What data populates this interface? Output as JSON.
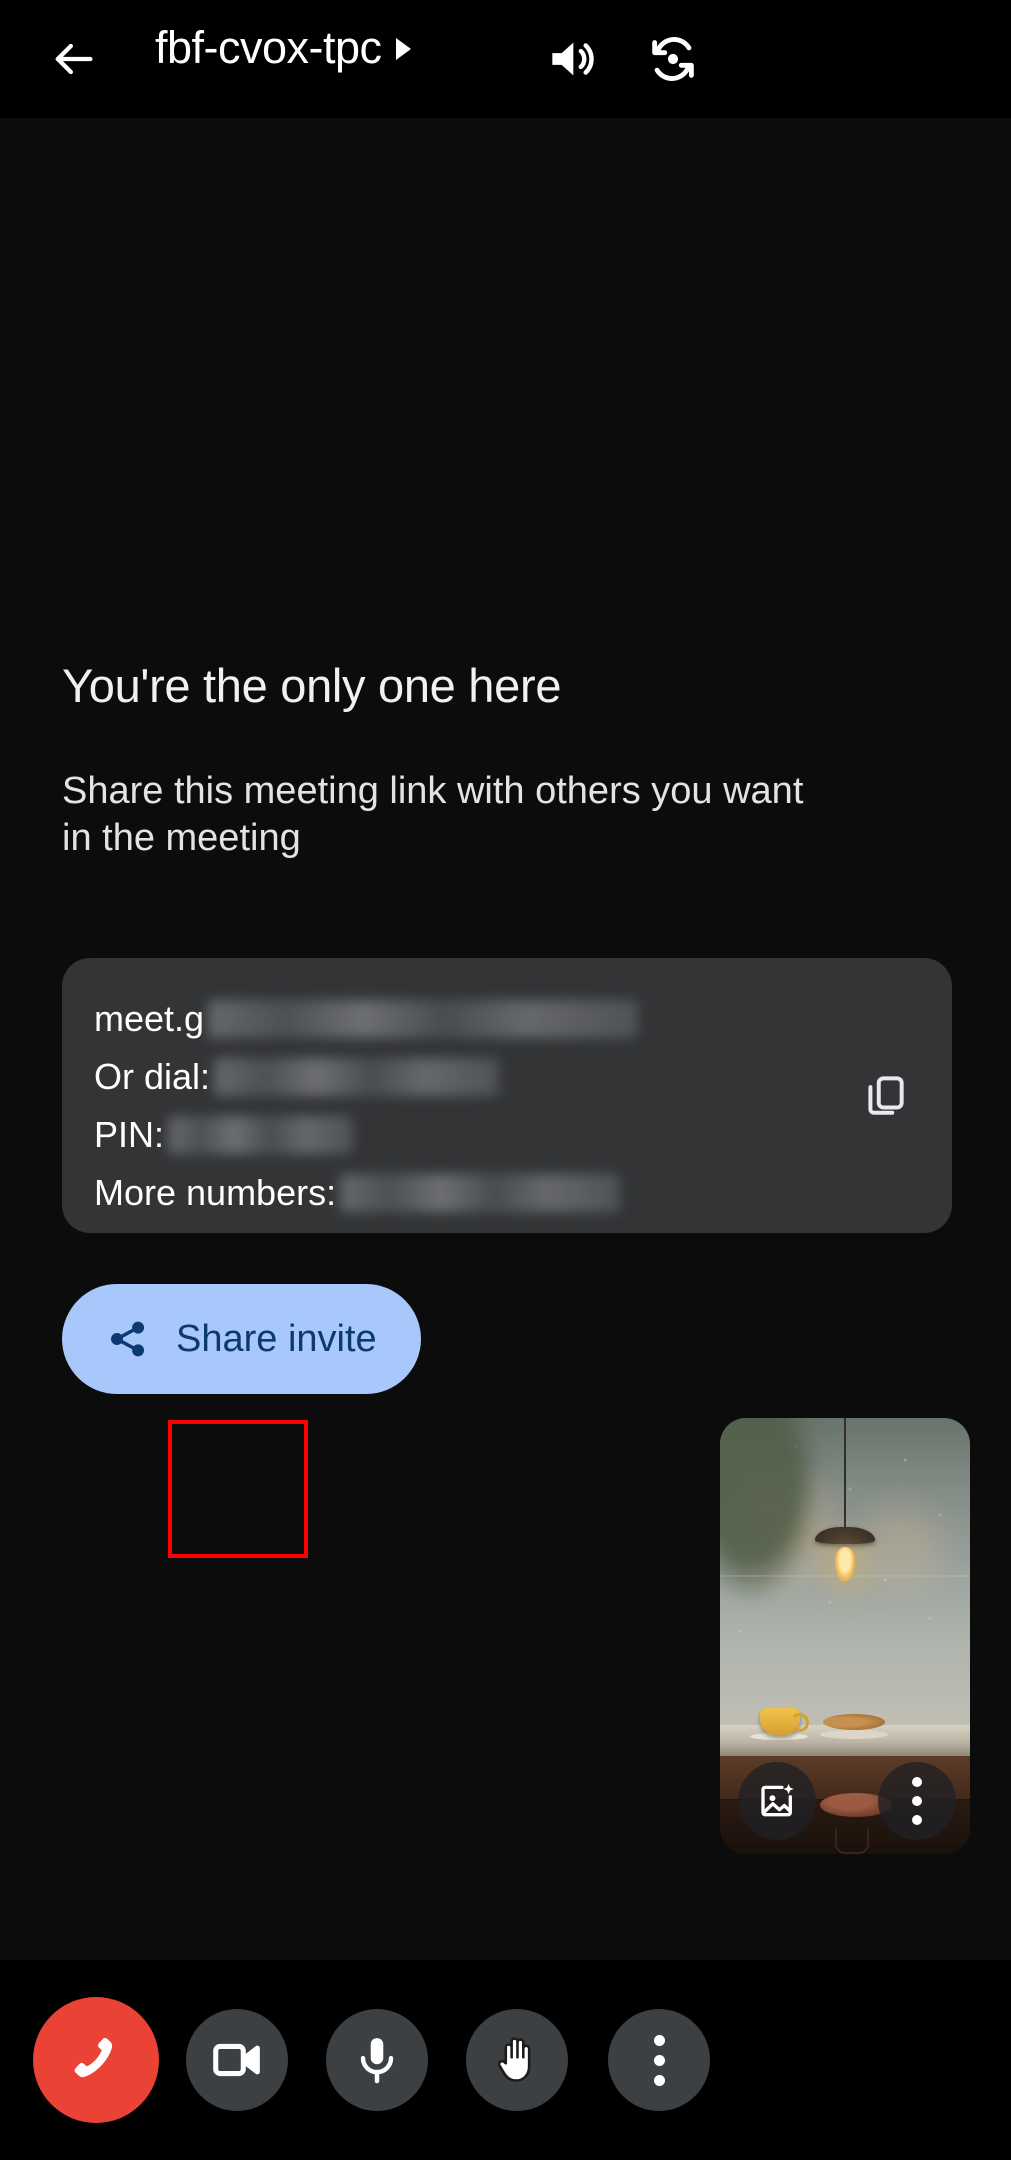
{
  "topbar": {
    "back_icon": "back-arrow-icon",
    "meeting_title": "fbf-cvox-tpc",
    "title_caret_icon": "chevron-right-icon",
    "speaker_icon": "speaker-volume-icon",
    "flip_camera_icon": "flip-camera-icon"
  },
  "main": {
    "headline": "You're the only one here",
    "subhead": "Share this meeting link with others you want in the meeting",
    "info_card": {
      "rows": [
        {
          "label": "meet.g",
          "redacted": true,
          "redact_width": 430
        },
        {
          "label": "Or dial:",
          "redacted": true,
          "redact_width": 285
        },
        {
          "label": "PIN:",
          "redacted": true,
          "redact_width": 185
        },
        {
          "label": "More numbers:",
          "redacted": true,
          "redact_width": 280
        }
      ],
      "copy_icon": "copy-icon",
      "background_color": "#323436"
    },
    "share_button": {
      "label": "Share invite",
      "icon": "share-icon",
      "background_color": "#a8c7fa",
      "text_color": "#0b3a70"
    },
    "self_view": {
      "description": "rainy cafe window virtual background",
      "effects_icon": "background-effects-icon",
      "more_icon": "more-vertical-icon"
    }
  },
  "controls": {
    "end_call": {
      "label": "End call",
      "icon": "end-call-icon",
      "color": "#ea4335"
    },
    "camera": {
      "label": "Camera",
      "icon": "video-camera-icon",
      "color": "#3c4043",
      "highlighted": true
    },
    "microphone": {
      "label": "Microphone",
      "icon": "microphone-icon",
      "color": "#3c4043"
    },
    "raise_hand": {
      "label": "Raise hand",
      "icon": "raise-hand-icon",
      "color": "#3c4043"
    },
    "more": {
      "label": "More options",
      "icon": "more-vertical-icon",
      "color": "#3c4043"
    }
  },
  "annotation": {
    "highlight_color": "#ff0000",
    "target": "camera-button"
  }
}
